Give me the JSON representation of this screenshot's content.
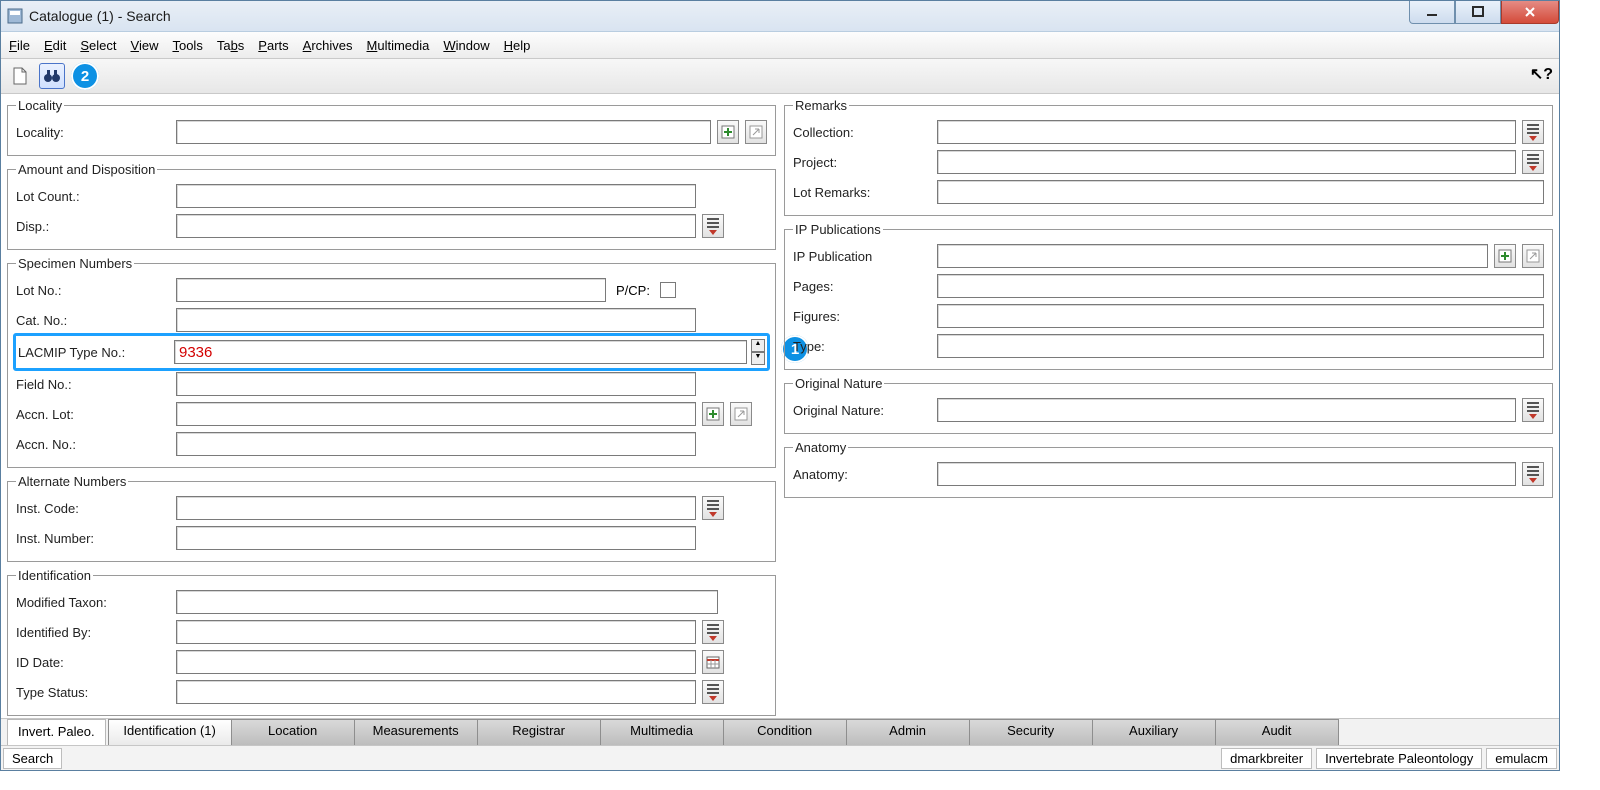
{
  "window": {
    "title": "Catalogue (1) - Search"
  },
  "menu": {
    "file": "File",
    "edit": "Edit",
    "select": "Select",
    "view": "View",
    "tools": "Tools",
    "tabs": "Tabs",
    "parts": "Parts",
    "archives": "Archives",
    "multimedia": "Multimedia",
    "window": "Window",
    "help": "Help"
  },
  "callouts": {
    "one": "1",
    "two": "2"
  },
  "help_cursor": "?",
  "groups": {
    "locality": {
      "legend": "Locality",
      "locality_label": "Locality:"
    },
    "amount": {
      "legend": "Amount and Disposition",
      "lot_count_label": "Lot Count.:",
      "disp_label": "Disp.:"
    },
    "specimen": {
      "legend": "Specimen Numbers",
      "lot_no_label": "Lot No.:",
      "pcp_label": "P/CP:",
      "cat_no_label": "Cat. No.:",
      "lacmip_label": "LACMIP Type No.:",
      "lacmip_value": "9336",
      "field_no_label": "Field No.:",
      "accn_lot_label": "Accn. Lot:",
      "accn_no_label": "Accn. No.:"
    },
    "alternate": {
      "legend": "Alternate Numbers",
      "inst_code_label": "Inst. Code:",
      "inst_number_label": "Inst. Number:"
    },
    "ident": {
      "legend": "Identification",
      "mod_taxon_label": "Modified Taxon:",
      "id_by_label": "Identified By:",
      "id_date_label": "ID Date:",
      "type_status_label": "Type Status:"
    },
    "remarks": {
      "legend": "Remarks",
      "collection_label": "Collection:",
      "project_label": "Project:",
      "lot_remarks_label": "Lot Remarks:"
    },
    "ippub": {
      "legend": "IP Publications",
      "ip_pub_label": "IP Publication",
      "pages_label": "Pages:",
      "figures_label": "Figures:",
      "type_label": "Type:"
    },
    "orignat": {
      "legend": "Original Nature",
      "label": "Original Nature:"
    },
    "anatomy": {
      "legend": "Anatomy",
      "label": "Anatomy:"
    }
  },
  "tabs": {
    "static": "Invert. Paleo.",
    "items": [
      {
        "label": "Identification (1)",
        "active": true
      },
      {
        "label": "Location"
      },
      {
        "label": "Measurements"
      },
      {
        "label": "Registrar"
      },
      {
        "label": "Multimedia"
      },
      {
        "label": "Condition"
      },
      {
        "label": "Admin"
      },
      {
        "label": "Security"
      },
      {
        "label": "Auxiliary"
      },
      {
        "label": "Audit"
      }
    ]
  },
  "status": {
    "mode": "Search",
    "user": "dmarkbreiter",
    "dept": "Invertebrate Paleontology",
    "host": "emulacm"
  }
}
